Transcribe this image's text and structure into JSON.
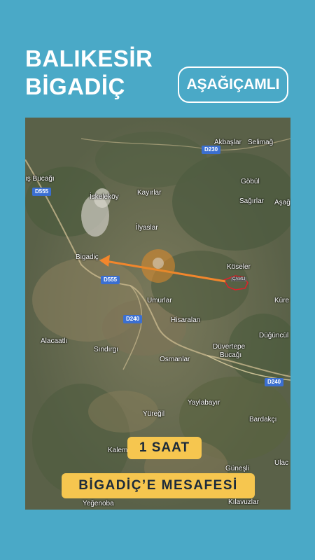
{
  "header": {
    "title_line1": "BALIKESİR",
    "title_line2": "BİGADİÇ",
    "badge": "AŞAĞIÇAMLI"
  },
  "map": {
    "places": {
      "akbaslar": "Akbaşlar",
      "selimag": "Selimağ",
      "bucagi_nw": "ış Bucağı",
      "gobul": "Göbül",
      "iskelekoy": "İskeleköy",
      "kayirlar": "Kayırlar",
      "sagirlar": "Sağırlar",
      "asag": "Aşağ",
      "ilyaslar": "İlyaslar",
      "bigadic": "Bigadiç",
      "koseler": "Köseler",
      "umurlar": "Umurlar",
      "kure": "Küre",
      "hisaralan": "Hisaralan",
      "alacaatli": "Alacaatlı",
      "duguncul": "Düğüncül",
      "duvertepe": "Düvertepe",
      "duvertepe2": "Bucağı",
      "sindirgi": "Sındırgı",
      "osmanlar": "Osmanlar",
      "yaylabayir": "Yaylabayır",
      "yuregil": "Yüreğil",
      "bardakci": "Bardakçı",
      "ulac": "Ulac",
      "kalemoglu": "Kalemoğlu",
      "gunesli": "Güneşli",
      "yegenoba": "Yeğenoba",
      "kilavuzlar": "Kılavuzlar",
      "origin_tag": "ÇAMLI"
    },
    "roads": {
      "d230": "D230",
      "d555a": "D555",
      "d555b": "D555",
      "d240a": "D240",
      "d240b": "D240"
    }
  },
  "labels": {
    "time": "1 SAAT",
    "distance": "BİGADİÇ’E MESAFESİ"
  },
  "colors": {
    "background": "#4aa9c7",
    "label_bg": "#f6c64f",
    "arrow": "#f2862c",
    "boundary": "#e0202a"
  }
}
